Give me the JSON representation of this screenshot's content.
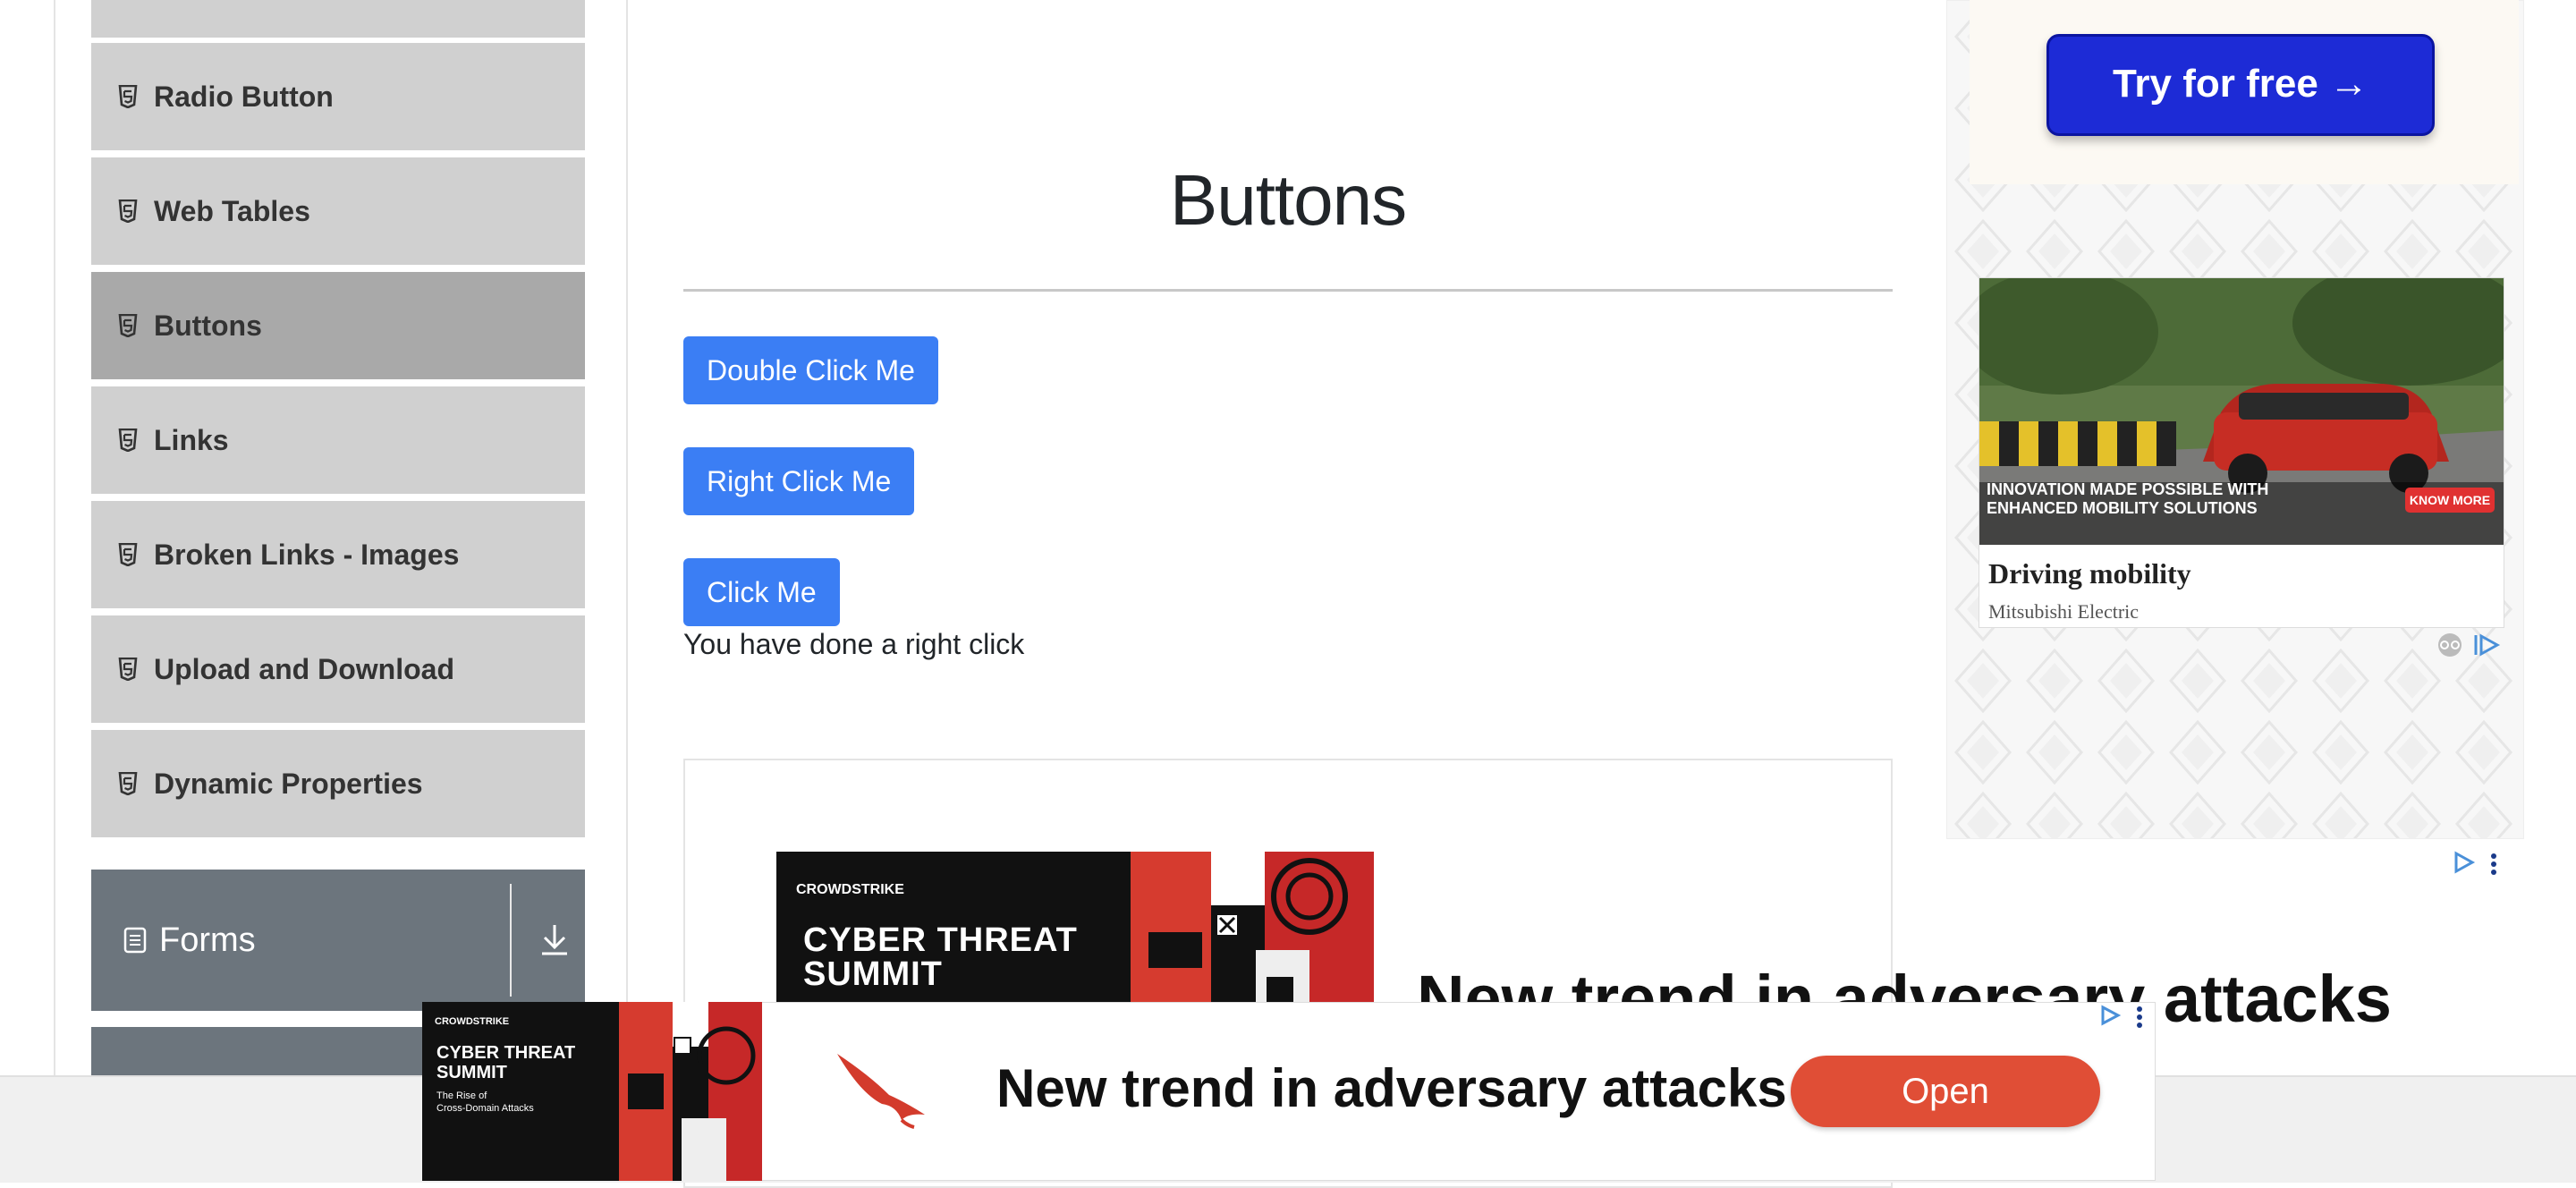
{
  "sidebar": {
    "items": [
      {
        "label": "Radio Button"
      },
      {
        "label": "Web Tables"
      },
      {
        "label": "Buttons"
      },
      {
        "label": "Links"
      },
      {
        "label": "Broken Links - Images"
      },
      {
        "label": "Upload and Download"
      },
      {
        "label": "Dynamic Properties"
      }
    ],
    "active_index": 2,
    "forms_group": {
      "label": "Forms"
    }
  },
  "main": {
    "title": "Buttons",
    "buttons": {
      "double_click": "Double Click Me",
      "right_click": "Right Click Me",
      "click": "Click Me"
    },
    "result_message": "You have done a right click"
  },
  "ads": {
    "right": {
      "cta_label": "Try for free →",
      "car_caption_line1": "INNOVATION MADE POSSIBLE WITH",
      "car_caption_line2": "ENHANCED MOBILITY SOLUTIONS",
      "know_more": "KNOW MORE",
      "title": "Driving mobility",
      "advertiser": "Mitsubishi Electric"
    },
    "inline": {
      "brand": "CROWDSTRIKE",
      "event_line1": "CYBER THREAT",
      "event_line2": "SUMMIT",
      "headline": "New trend in adversary attacks"
    },
    "sticky": {
      "brand": "CROWDSTRIKE",
      "event_line1": "CYBER THREAT",
      "event_line2": "SUMMIT",
      "subtitle_line1": "The Rise of",
      "subtitle_line2": "Cross-Domain Attacks",
      "headline": "New trend in adversary attacks",
      "cta": "Open"
    }
  },
  "colors": {
    "primary_button": "#3b7ef4",
    "sidebar_item": "#d0d0d0",
    "sidebar_active": "#a9a9a9",
    "group_header": "#6c757d",
    "open_button": "#e04e36",
    "try_button": "#1d2bd6"
  }
}
